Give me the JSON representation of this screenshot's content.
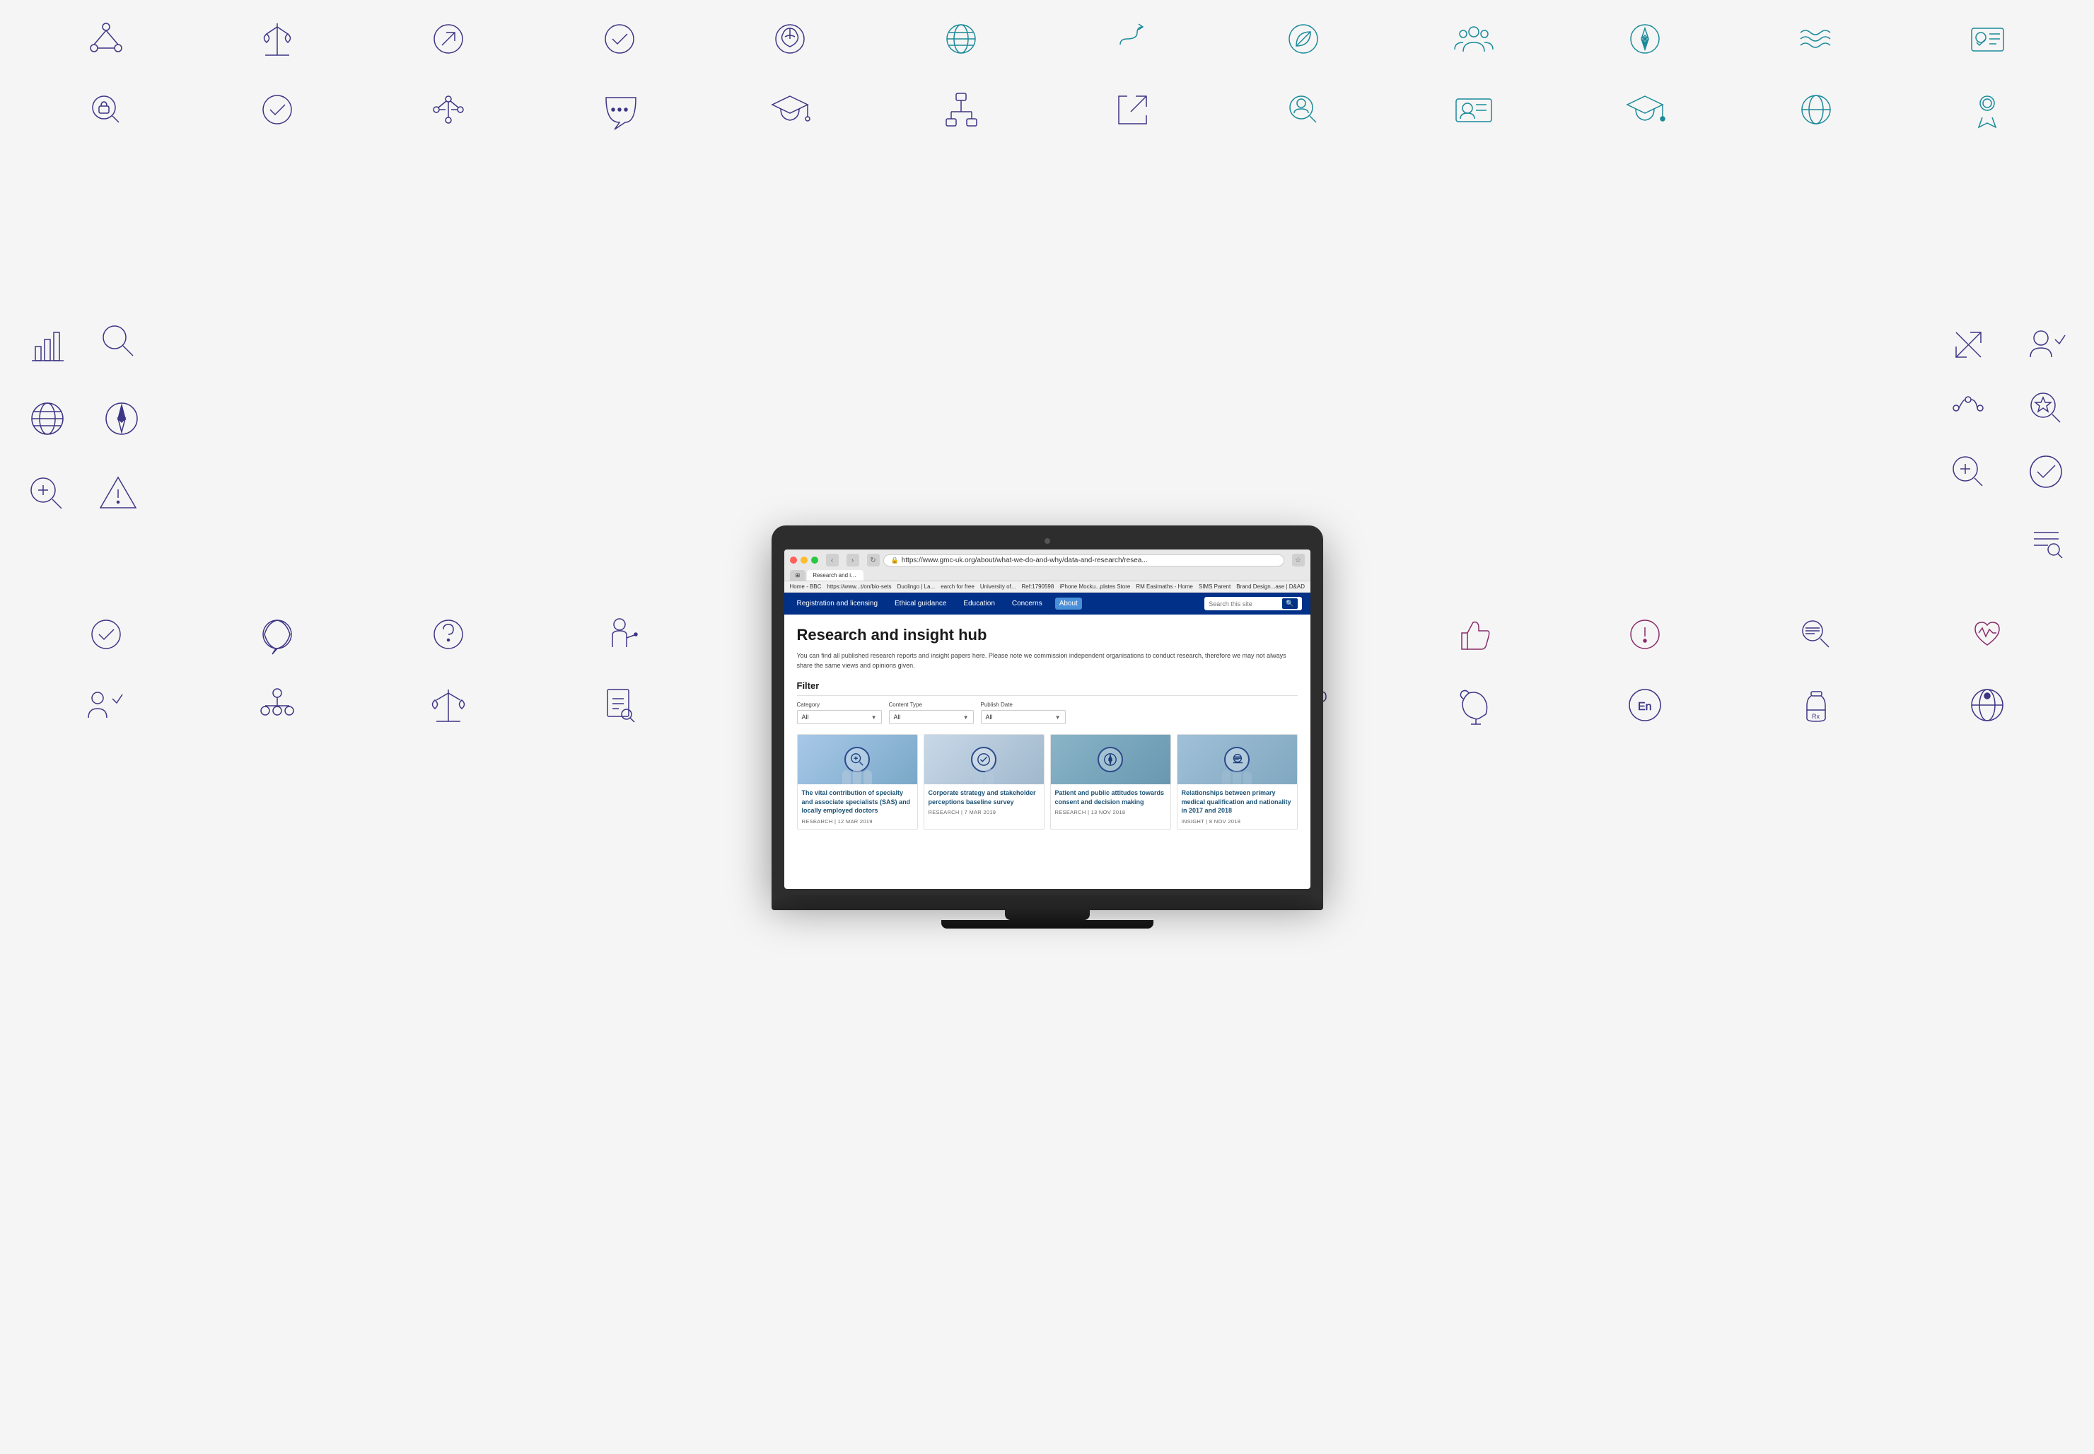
{
  "page": {
    "background_color": "#f0f0f0"
  },
  "browser": {
    "url": "https://www.gmc-uk.org/about/what-we-do-and-why/data-and-research/resea...",
    "tab_label": "Research and insight archive - GMC",
    "bookmarks": [
      "Home - BBC",
      "https://www...t/on/bio-sets",
      "Duolingo | La...",
      "earch for free",
      "University of...",
      "Ref:1790598",
      "iPhone Mocku...plates Store",
      "RM Easimaths - Home",
      "SIMS Parent",
      "Brand Design...ase | D&AD"
    ]
  },
  "nav": {
    "items": [
      {
        "label": "Registration and licensing"
      },
      {
        "label": "Ethical guidance"
      },
      {
        "label": "Education"
      },
      {
        "label": "Concerns"
      },
      {
        "label": "About",
        "active": true
      }
    ],
    "search_placeholder": "Search this site"
  },
  "page_content": {
    "title": "Research and insight hub",
    "description": "You can find all published research reports and insight papers here. Please note we commission independent organisations to conduct research, therefore we may not always share the same views and opinions given.",
    "filter_section": {
      "title": "Filter",
      "filters": [
        {
          "label": "Category",
          "value": "All"
        },
        {
          "label": "Content Type",
          "value": "All"
        },
        {
          "label": "Publish Date",
          "value": "All"
        }
      ]
    },
    "cards": [
      {
        "title": "The vital contribution of specialty and associate specialists (SAS) and locally employed doctors",
        "meta": "RESEARCH | 12 MAR 2019",
        "icon": "search-zoom"
      },
      {
        "title": "Corporate strategy and stakeholder perceptions baseline survey",
        "meta": "RESEARCH | 7 MAR 2019",
        "icon": "checkmark-circle"
      },
      {
        "title": "Patient and public attitudes towards consent and decision making",
        "meta": "RESEARCH | 13 NOV 2018",
        "icon": "compass"
      },
      {
        "title": "Relationships between primary medical qualification and nationality in 2017 and 2018",
        "meta": "INSIGHT | 8 NOV 2018",
        "icon": "search-lines"
      }
    ]
  },
  "icons": {
    "row1": [
      {
        "name": "network-nodes",
        "color": "purple"
      },
      {
        "name": "scales-balance",
        "color": "purple"
      },
      {
        "name": "arrow-up-right-circle",
        "color": "purple"
      },
      {
        "name": "check-circle",
        "color": "purple"
      },
      {
        "name": "brain-head",
        "color": "purple"
      },
      {
        "name": "globe",
        "color": "teal"
      },
      {
        "name": "arrow-path",
        "color": "teal"
      },
      {
        "name": "leaf-circle",
        "color": "teal"
      },
      {
        "name": "people-group",
        "color": "teal"
      },
      {
        "name": "compass-circle",
        "color": "teal"
      },
      {
        "name": "wave-lines",
        "color": "teal"
      },
      {
        "name": "id-verify",
        "color": "teal"
      }
    ],
    "row2": [
      {
        "name": "lock-search",
        "color": "purple"
      },
      {
        "name": "check-circle-2",
        "color": "purple"
      },
      {
        "name": "network-dots",
        "color": "purple"
      },
      {
        "name": "chat-dots",
        "color": "purple"
      },
      {
        "name": "graduation-cap",
        "color": "purple"
      },
      {
        "name": "hierarchy",
        "color": "purple"
      },
      {
        "name": "external-link",
        "color": "purple"
      },
      {
        "name": "search-person",
        "color": "teal"
      },
      {
        "name": "id-card",
        "color": "teal"
      },
      {
        "name": "graduation-cap-2",
        "color": "teal"
      },
      {
        "name": "globe-2",
        "color": "teal"
      },
      {
        "name": "award-person",
        "color": "teal"
      }
    ]
  }
}
